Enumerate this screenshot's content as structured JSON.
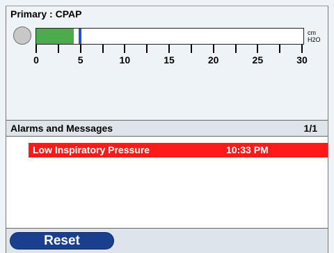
{
  "mode": {
    "title": "Primary : CPAP"
  },
  "gauge": {
    "unit_line1": "cm",
    "unit_line2": "H2O",
    "range": [
      0,
      30
    ],
    "tick_labels": [
      "0",
      "5",
      "10",
      "15",
      "20",
      "25",
      "30"
    ],
    "fill_value": 4.2,
    "marker_value": 4.6,
    "fill_color": "#4cac4c",
    "marker_color": "#2255cc",
    "knob_icon": "circle-indicator-icon"
  },
  "alarms": {
    "header": "Alarms and Messages",
    "page": "1/1",
    "items": [
      {
        "message": "Low Inspiratory Pressure",
        "time": "10:33 PM",
        "color": "#ff1a1a"
      }
    ]
  },
  "footer": {
    "reset_label": "Reset"
  }
}
